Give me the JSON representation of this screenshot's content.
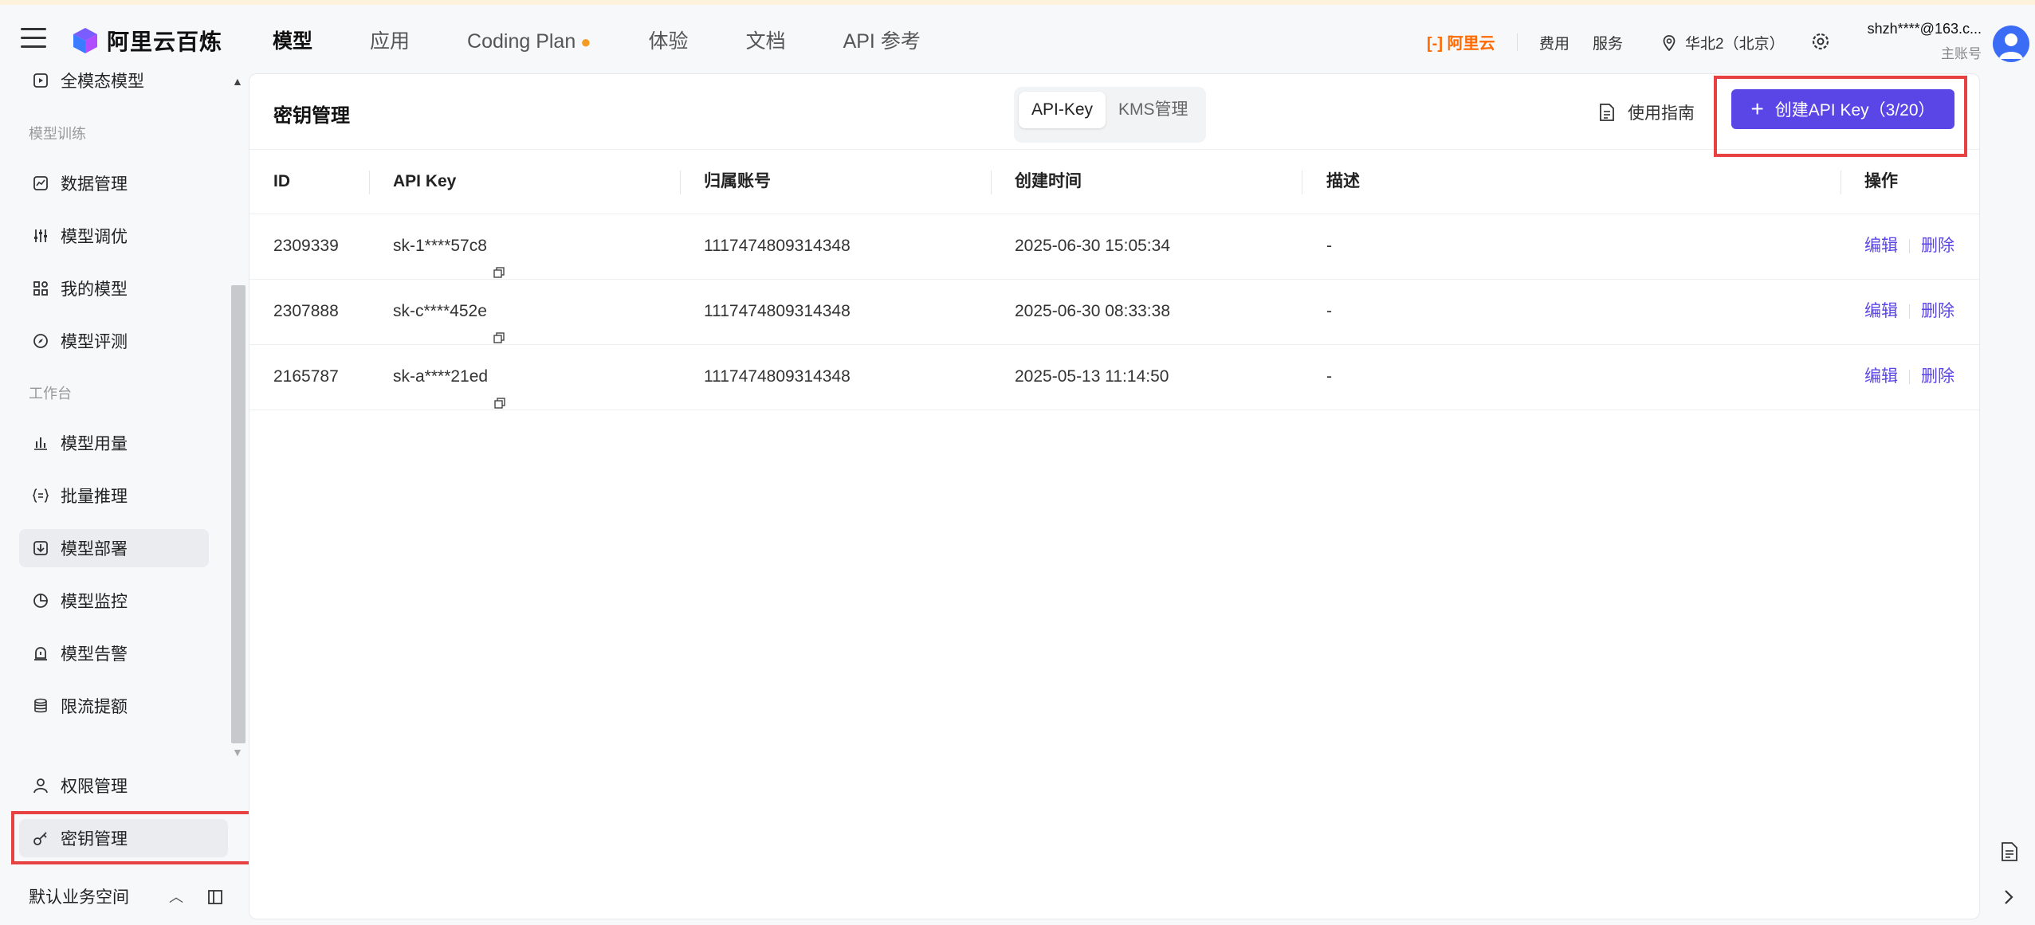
{
  "header": {
    "logo_text": "阿里云百炼",
    "nav": [
      "模型",
      "应用",
      "Coding Plan",
      "体验",
      "文档",
      "API 参考"
    ],
    "nav_active": "模型",
    "aliyun_label": "阿里云",
    "links": {
      "cost": "费用",
      "service": "服务"
    },
    "region": "华北2（北京）",
    "account_email": "shzh****@163.c...",
    "account_role": "主账号"
  },
  "sidebar": {
    "top_item": "全模态模型",
    "section_training": "模型训练",
    "training_items": [
      "数据管理",
      "模型调优",
      "我的模型",
      "模型评测"
    ],
    "section_workbench": "工作台",
    "workbench_items": [
      "模型用量",
      "批量推理",
      "模型部署",
      "模型监控",
      "模型告警",
      "限流提额"
    ],
    "bottom_items": [
      "权限管理",
      "密钥管理"
    ],
    "workspace": "默认业务空间"
  },
  "main": {
    "title": "密钥管理",
    "tabs": [
      "API-Key",
      "KMS管理"
    ],
    "active_tab": "API-Key",
    "guide_label": "使用指南",
    "create_label": "创建API Key（3/20）"
  },
  "table": {
    "columns": [
      "ID",
      "API Key",
      "归属账号",
      "创建时间",
      "描述",
      "操作"
    ],
    "rows": [
      {
        "id": "2309339",
        "key": "sk-1****57c8",
        "account": "1117474809314348",
        "created": "2025-06-30 15:05:34",
        "desc": "-",
        "edit": "编辑",
        "delete": "删除"
      },
      {
        "id": "2307888",
        "key": "sk-c****452e",
        "account": "1117474809314348",
        "created": "2025-06-30 08:33:38",
        "desc": "-",
        "edit": "编辑",
        "delete": "删除"
      },
      {
        "id": "2165787",
        "key": "sk-a****21ed",
        "account": "1117474809314348",
        "created": "2025-05-13 11:14:50",
        "desc": "-",
        "edit": "编辑",
        "delete": "删除"
      }
    ]
  },
  "colors": {
    "primary": "#5a45e6",
    "highlight": "#e84141",
    "aliyun": "#ff6a00"
  }
}
